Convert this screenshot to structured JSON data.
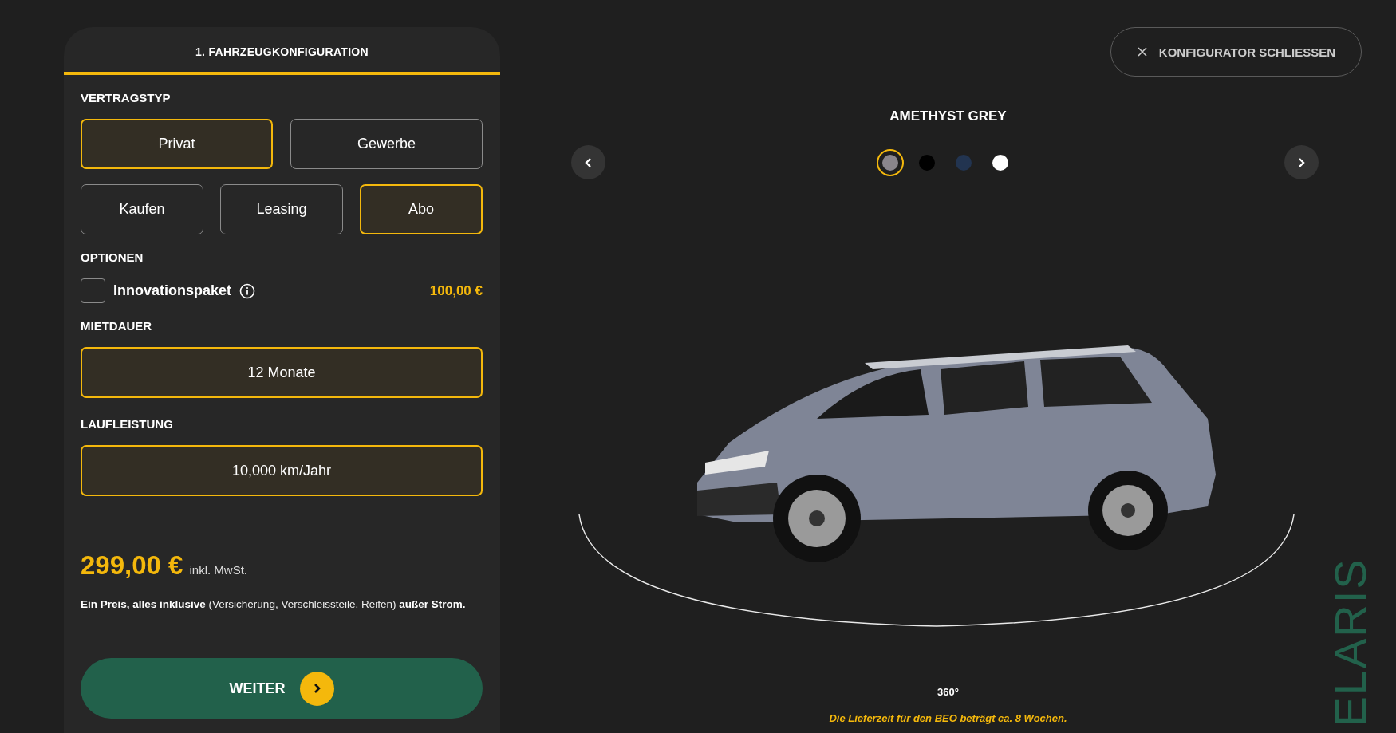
{
  "panel": {
    "tab": "1. FAHRZEUGKONFIGURATION",
    "contract_label": "VERTRAGSTYP",
    "customer_types": [
      {
        "label": "Privat",
        "selected": true
      },
      {
        "label": "Gewerbe",
        "selected": false
      }
    ],
    "contract_types": [
      {
        "label": "Kaufen",
        "selected": false
      },
      {
        "label": "Leasing",
        "selected": false
      },
      {
        "label": "Abo",
        "selected": true
      }
    ],
    "options_label": "OPTIONEN",
    "options": [
      {
        "label": "Innovationspaket",
        "price": "100,00 €",
        "checked": false
      }
    ],
    "duration_label": "MIETDAUER",
    "duration": "12 Monate",
    "mileage_label": "LAUFLEISTUNG",
    "mileage": "10,000 km/Jahr",
    "price": "299,00 €",
    "price_note": "inkl. MwSt.",
    "info": "**Ein Preis, alles inklusive** (Versicherung, Verschleissteile, Reifen) **außer Strom.**",
    "next_button": "WEITER"
  },
  "viewer": {
    "close_button": "KONFIGURATOR SCHLIESSEN",
    "color_name": "AMETHYST GREY",
    "colors": [
      {
        "color": "#8a868c",
        "selected": true
      },
      {
        "color": "#000000",
        "selected": false
      },
      {
        "color": "#223450",
        "selected": false
      },
      {
        "color": "#ffffff",
        "selected": false
      }
    ],
    "rotation_label": "360°",
    "delivery_note": "Die Lieferzeit für den BEO beträgt ca. 8 Wochen.",
    "brand": "ELARIS"
  }
}
